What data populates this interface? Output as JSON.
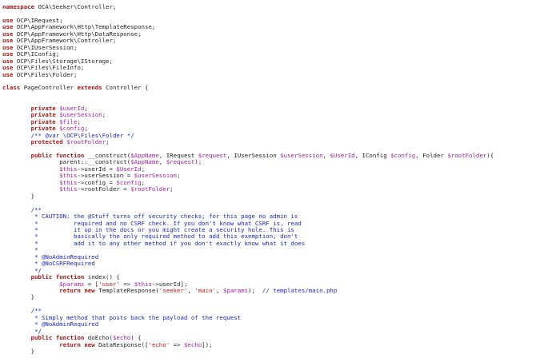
{
  "editor": {
    "lines": [
      [
        {
          "t": "kw",
          "v": "namespace"
        },
        {
          "t": "plain",
          "v": " OCA\\Seeker\\Controller;"
        }
      ],
      [],
      [
        {
          "t": "kw",
          "v": "use"
        },
        {
          "t": "plain",
          "v": " OCP\\IRequest;"
        }
      ],
      [
        {
          "t": "kw",
          "v": "use"
        },
        {
          "t": "plain",
          "v": " OCP\\AppFramework\\Http\\TemplateResponse;"
        }
      ],
      [
        {
          "t": "kw",
          "v": "use"
        },
        {
          "t": "plain",
          "v": " OCP\\AppFramework\\Http\\DataResponse;"
        }
      ],
      [
        {
          "t": "kw",
          "v": "use"
        },
        {
          "t": "plain",
          "v": " OCP\\AppFramework\\Controller;"
        }
      ],
      [
        {
          "t": "kw",
          "v": "use"
        },
        {
          "t": "plain",
          "v": " OCP\\IUserSession;"
        }
      ],
      [
        {
          "t": "kw",
          "v": "use"
        },
        {
          "t": "plain",
          "v": " OCP\\IConfig;"
        }
      ],
      [
        {
          "t": "kw",
          "v": "use"
        },
        {
          "t": "plain",
          "v": " OCP\\Files\\Storage\\IStorage;"
        }
      ],
      [
        {
          "t": "kw",
          "v": "use"
        },
        {
          "t": "plain",
          "v": " OCP\\Files\\FileInfo;"
        }
      ],
      [
        {
          "t": "kw",
          "v": "use"
        },
        {
          "t": "plain",
          "v": " OCP\\Files\\Folder;"
        }
      ],
      [],
      [
        {
          "t": "kw",
          "v": "class"
        },
        {
          "t": "plain",
          "v": " PageController "
        },
        {
          "t": "kw",
          "v": "extends"
        },
        {
          "t": "plain",
          "v": " Controller {"
        }
      ],
      [],
      [],
      [
        {
          "t": "plain",
          "v": "        "
        },
        {
          "t": "kw",
          "v": "private"
        },
        {
          "t": "plain",
          "v": " "
        },
        {
          "t": "var",
          "v": "$userId"
        },
        {
          "t": "plain",
          "v": ";"
        }
      ],
      [
        {
          "t": "plain",
          "v": "        "
        },
        {
          "t": "kw",
          "v": "private"
        },
        {
          "t": "plain",
          "v": " "
        },
        {
          "t": "var",
          "v": "$userSession"
        },
        {
          "t": "plain",
          "v": ";"
        }
      ],
      [
        {
          "t": "plain",
          "v": "        "
        },
        {
          "t": "kw",
          "v": "private"
        },
        {
          "t": "plain",
          "v": " "
        },
        {
          "t": "var",
          "v": "$file"
        },
        {
          "t": "plain",
          "v": ";"
        }
      ],
      [
        {
          "t": "plain",
          "v": "        "
        },
        {
          "t": "kw",
          "v": "private"
        },
        {
          "t": "plain",
          "v": " "
        },
        {
          "t": "var",
          "v": "$config"
        },
        {
          "t": "plain",
          "v": ";"
        }
      ],
      [
        {
          "t": "plain",
          "v": "        "
        },
        {
          "t": "comment",
          "v": "/** @var \\OCP\\Files\\Folder */"
        }
      ],
      [
        {
          "t": "plain",
          "v": "        "
        },
        {
          "t": "kw",
          "v": "protected"
        },
        {
          "t": "plain",
          "v": " "
        },
        {
          "t": "var",
          "v": "$rootFolder"
        },
        {
          "t": "plain",
          "v": ";"
        }
      ],
      [],
      [
        {
          "t": "plain",
          "v": "        "
        },
        {
          "t": "kw",
          "v": "public function"
        },
        {
          "t": "plain",
          "v": " __construct("
        },
        {
          "t": "var",
          "v": "$AppName"
        },
        {
          "t": "plain",
          "v": ", IRequest "
        },
        {
          "t": "var",
          "v": "$request"
        },
        {
          "t": "plain",
          "v": ", IUserSession "
        },
        {
          "t": "var",
          "v": "$userSession"
        },
        {
          "t": "plain",
          "v": ", "
        },
        {
          "t": "var",
          "v": "$UserId"
        },
        {
          "t": "plain",
          "v": ", IConfig "
        },
        {
          "t": "var",
          "v": "$config"
        },
        {
          "t": "plain",
          "v": ", Folder "
        },
        {
          "t": "var",
          "v": "$rootFolder"
        },
        {
          "t": "plain",
          "v": "){"
        }
      ],
      [
        {
          "t": "plain",
          "v": "                parent::__construct("
        },
        {
          "t": "var",
          "v": "$AppName"
        },
        {
          "t": "plain",
          "v": ", "
        },
        {
          "t": "var",
          "v": "$request"
        },
        {
          "t": "plain",
          "v": ");"
        }
      ],
      [
        {
          "t": "plain",
          "v": "                "
        },
        {
          "t": "var",
          "v": "$this"
        },
        {
          "t": "plain",
          "v": "->userId = "
        },
        {
          "t": "var",
          "v": "$UserId"
        },
        {
          "t": "plain",
          "v": ";"
        }
      ],
      [
        {
          "t": "plain",
          "v": "                "
        },
        {
          "t": "var",
          "v": "$this"
        },
        {
          "t": "plain",
          "v": "->userSession = "
        },
        {
          "t": "var",
          "v": "$userSession"
        },
        {
          "t": "plain",
          "v": ";"
        }
      ],
      [
        {
          "t": "plain",
          "v": "                "
        },
        {
          "t": "var",
          "v": "$this"
        },
        {
          "t": "plain",
          "v": "->config = "
        },
        {
          "t": "var",
          "v": "$config"
        },
        {
          "t": "plain",
          "v": ";"
        }
      ],
      [
        {
          "t": "plain",
          "v": "                "
        },
        {
          "t": "var",
          "v": "$this"
        },
        {
          "t": "plain",
          "v": "->rootFolder = "
        },
        {
          "t": "var",
          "v": "$rootFolder"
        },
        {
          "t": "plain",
          "v": ";"
        }
      ],
      [
        {
          "t": "plain",
          "v": "        }"
        }
      ],
      [],
      [
        {
          "t": "plain",
          "v": "        "
        },
        {
          "t": "comment",
          "v": "/**"
        }
      ],
      [
        {
          "t": "plain",
          "v": "         "
        },
        {
          "t": "comment",
          "v": "* CAUTION: the @Stuff turns off security checks; for this page no admin is"
        }
      ],
      [
        {
          "t": "plain",
          "v": "         "
        },
        {
          "t": "comment",
          "v": "*          required and no CSRF check. If you don't know what CSRF is, read"
        }
      ],
      [
        {
          "t": "plain",
          "v": "         "
        },
        {
          "t": "comment",
          "v": "*          it up in the docs or you might create a security hole. This is"
        }
      ],
      [
        {
          "t": "plain",
          "v": "         "
        },
        {
          "t": "comment",
          "v": "*          basically the only required method to add this exemption, don't"
        }
      ],
      [
        {
          "t": "plain",
          "v": "         "
        },
        {
          "t": "comment",
          "v": "*          add it to any other method if you don't exactly know what it does"
        }
      ],
      [
        {
          "t": "plain",
          "v": "         "
        },
        {
          "t": "comment",
          "v": "*"
        }
      ],
      [
        {
          "t": "plain",
          "v": "         "
        },
        {
          "t": "comment",
          "v": "* @NoAdminRequired"
        }
      ],
      [
        {
          "t": "plain",
          "v": "         "
        },
        {
          "t": "comment",
          "v": "* @NoCSRFRequired"
        }
      ],
      [
        {
          "t": "plain",
          "v": "         "
        },
        {
          "t": "comment",
          "v": "*/"
        }
      ],
      [
        {
          "t": "plain",
          "v": "        "
        },
        {
          "t": "kw",
          "v": "public function"
        },
        {
          "t": "plain",
          "v": " index() {"
        }
      ],
      [
        {
          "t": "plain",
          "v": "                "
        },
        {
          "t": "var",
          "v": "$params"
        },
        {
          "t": "plain",
          "v": " = ["
        },
        {
          "t": "str",
          "v": "'user'"
        },
        {
          "t": "plain",
          "v": " => "
        },
        {
          "t": "var",
          "v": "$this"
        },
        {
          "t": "plain",
          "v": "->userId];"
        }
      ],
      [
        {
          "t": "plain",
          "v": "                "
        },
        {
          "t": "kw",
          "v": "return new"
        },
        {
          "t": "plain",
          "v": " TemplateResponse("
        },
        {
          "t": "str",
          "v": "'seeker'"
        },
        {
          "t": "plain",
          "v": ", "
        },
        {
          "t": "str",
          "v": "'main'"
        },
        {
          "t": "plain",
          "v": ", "
        },
        {
          "t": "var",
          "v": "$params"
        },
        {
          "t": "plain",
          "v": ");  "
        },
        {
          "t": "comment",
          "v": "// templates/main.php"
        }
      ],
      [
        {
          "t": "plain",
          "v": "        }"
        }
      ],
      [],
      [
        {
          "t": "plain",
          "v": "        "
        },
        {
          "t": "comment",
          "v": "/**"
        }
      ],
      [
        {
          "t": "plain",
          "v": "         "
        },
        {
          "t": "comment",
          "v": "* Simply method that posts back the payload of the request"
        }
      ],
      [
        {
          "t": "plain",
          "v": "         "
        },
        {
          "t": "comment",
          "v": "* @NoAdminRequired"
        }
      ],
      [
        {
          "t": "plain",
          "v": "         "
        },
        {
          "t": "comment",
          "v": "*/"
        }
      ],
      [
        {
          "t": "plain",
          "v": "        "
        },
        {
          "t": "kw",
          "v": "public function"
        },
        {
          "t": "plain",
          "v": " doEcho("
        },
        {
          "t": "var",
          "v": "$echo"
        },
        {
          "t": "plain",
          "v": ") {"
        }
      ],
      [
        {
          "t": "plain",
          "v": "                "
        },
        {
          "t": "kw",
          "v": "return new"
        },
        {
          "t": "plain",
          "v": " DataResponse(["
        },
        {
          "t": "str",
          "v": "'echo'"
        },
        {
          "t": "plain",
          "v": " => "
        },
        {
          "t": "var",
          "v": "$echo"
        },
        {
          "t": "plain",
          "v": "]);"
        }
      ],
      [
        {
          "t": "plain",
          "v": "        }"
        }
      ]
    ]
  }
}
